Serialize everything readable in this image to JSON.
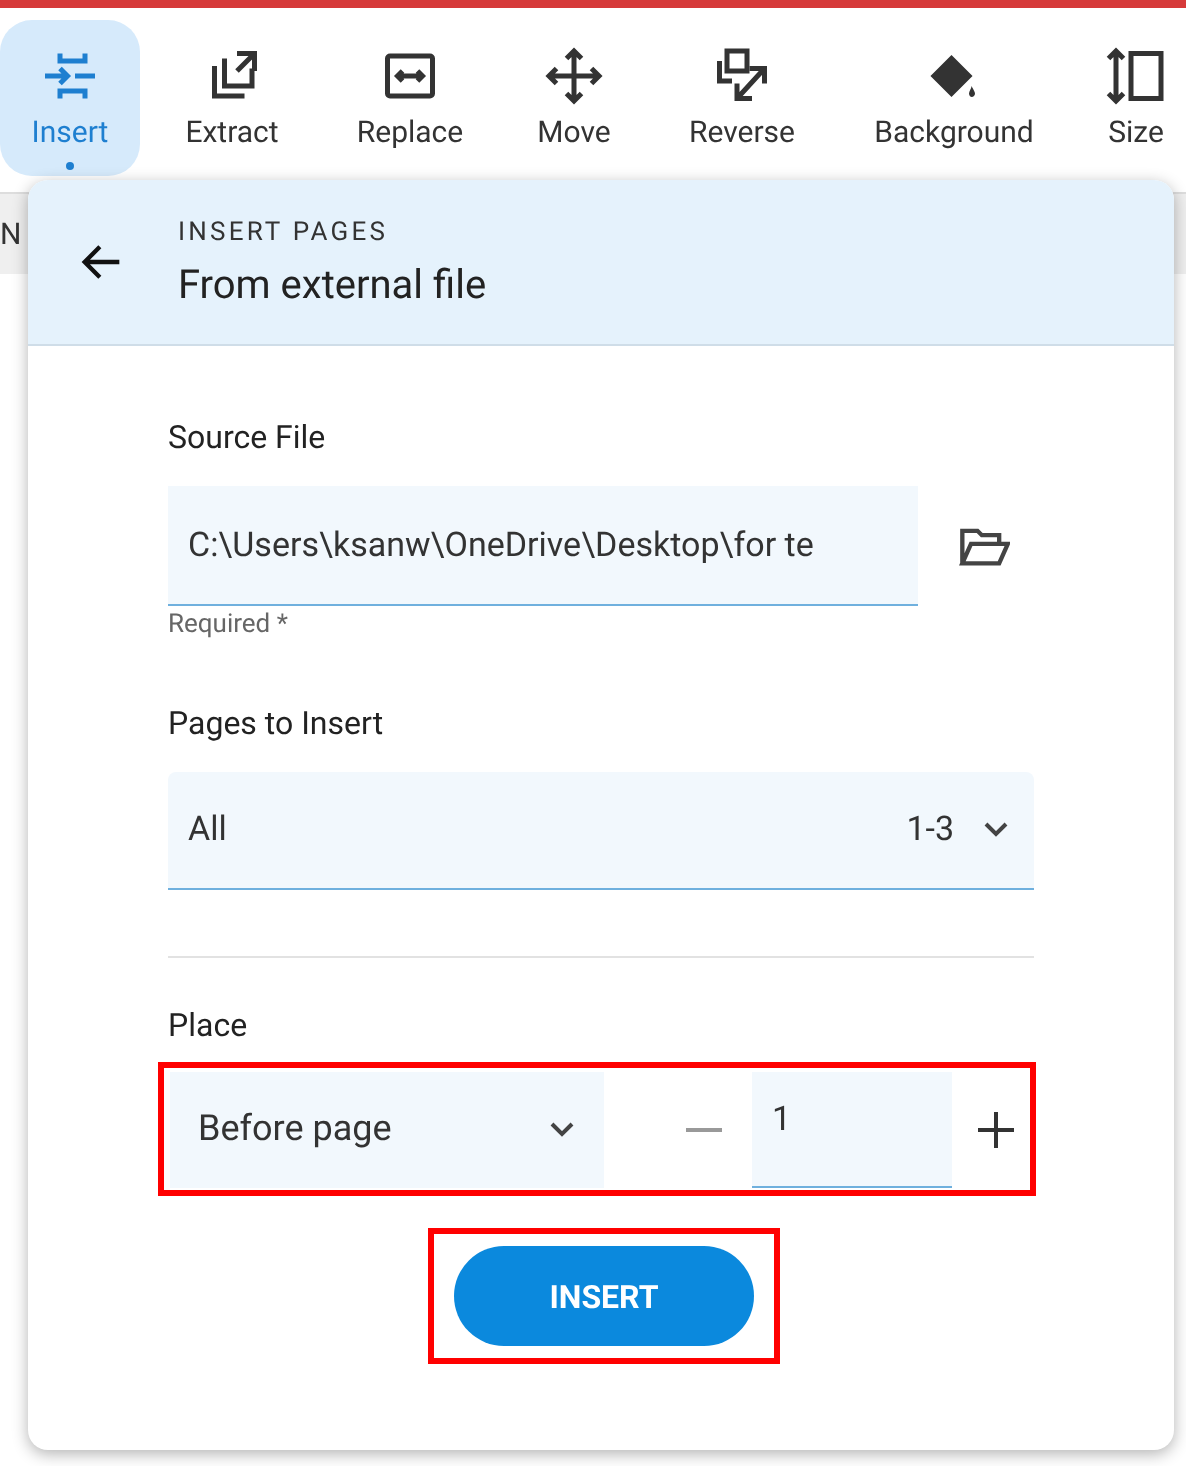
{
  "toolbar": [
    {
      "label": "Insert",
      "selected": true
    },
    {
      "label": "Extract",
      "selected": false
    },
    {
      "label": "Replace",
      "selected": false
    },
    {
      "label": "Move",
      "selected": false
    },
    {
      "label": "Reverse",
      "selected": false
    },
    {
      "label": "Background",
      "selected": false
    },
    {
      "label": "Size",
      "selected": false
    }
  ],
  "behind_text": "N",
  "panel": {
    "overline": "INSERT PAGES",
    "title": "From external file",
    "source_file": {
      "label": "Source File",
      "value": "C:\\Users\\ksanw\\OneDrive\\Desktop\\for te",
      "hint": "Required *"
    },
    "pages": {
      "label": "Pages to Insert",
      "value": "All",
      "range": "1-3"
    },
    "place": {
      "label": "Place",
      "mode": "Before page",
      "page": "1",
      "highlighted": true
    },
    "insert_button": {
      "label": "INSERT",
      "highlighted": true
    }
  }
}
